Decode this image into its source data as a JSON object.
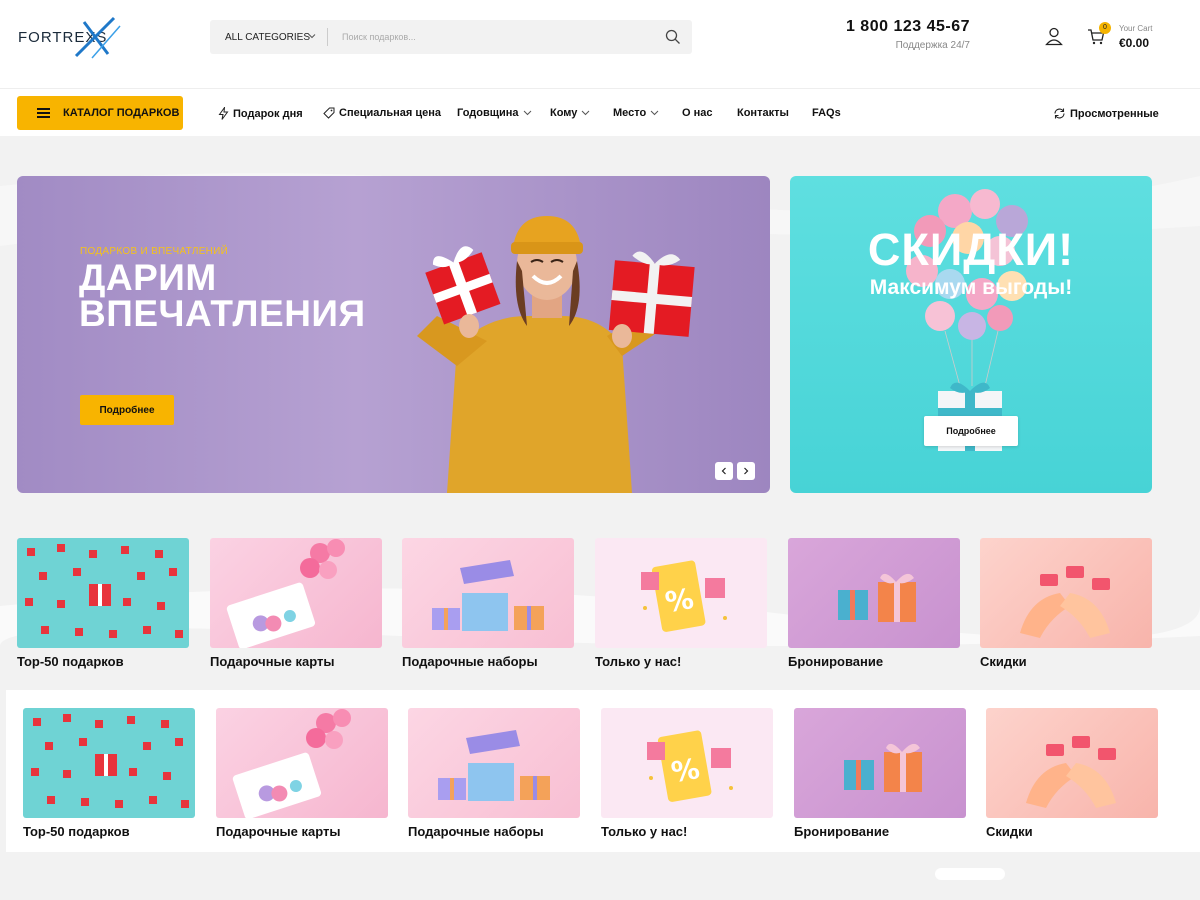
{
  "header": {
    "logo_text": "FORTREXS",
    "search": {
      "category": "ALL CATEGORIES",
      "placeholder": "Поиск подарков..."
    },
    "phone": "1 800 123 45-67",
    "support": "Поддержка 24/7",
    "cart": {
      "count": "0",
      "label": "Your Cart",
      "amount": "€0.00"
    }
  },
  "nav": {
    "catalog": "КАТАЛОГ ПОДАРКОВ",
    "items": [
      {
        "label": "Подарок дня",
        "icon": "lightning-icon"
      },
      {
        "label": "Специальная цена",
        "icon": "tag-icon"
      },
      {
        "label": "Годовщина",
        "dropdown": true
      },
      {
        "label": "Кому",
        "dropdown": true
      },
      {
        "label": "Место",
        "dropdown": true
      },
      {
        "label": "О нас"
      },
      {
        "label": "Контакты"
      },
      {
        "label": "FAQs"
      }
    ],
    "viewed": "Просмотренные"
  },
  "hero": {
    "subtitle": "ПОДАРКОВ И ВПЕЧАТЛЕНИЙ",
    "title_line1": "ДАРИМ",
    "title_line2": "ВПЕЧАТЛЕНИЯ",
    "button": "Подробнее"
  },
  "promo": {
    "title": "СКИДКИ!",
    "subtitle": "Максимум выгоды!",
    "button": "Подробнее"
  },
  "categories": [
    {
      "label": "Top-50 подарков",
      "image": "red-gifts-pattern"
    },
    {
      "label": "Подарочные карты",
      "image": "gift-card-balloons"
    },
    {
      "label": "Подарочные наборы",
      "image": "open-gift-boxes"
    },
    {
      "label": "Только у нас!",
      "image": "percent-coupon"
    },
    {
      "label": "Бронирование",
      "image": "two-gift-boxes"
    },
    {
      "label": "Скидки",
      "image": "hands-discount-tags"
    }
  ],
  "colors": {
    "accent": "#f8b400",
    "hero_bg": "#a18bc4",
    "promo_bg": "#4fd6d8",
    "logo_blue": "#1f78c8"
  }
}
